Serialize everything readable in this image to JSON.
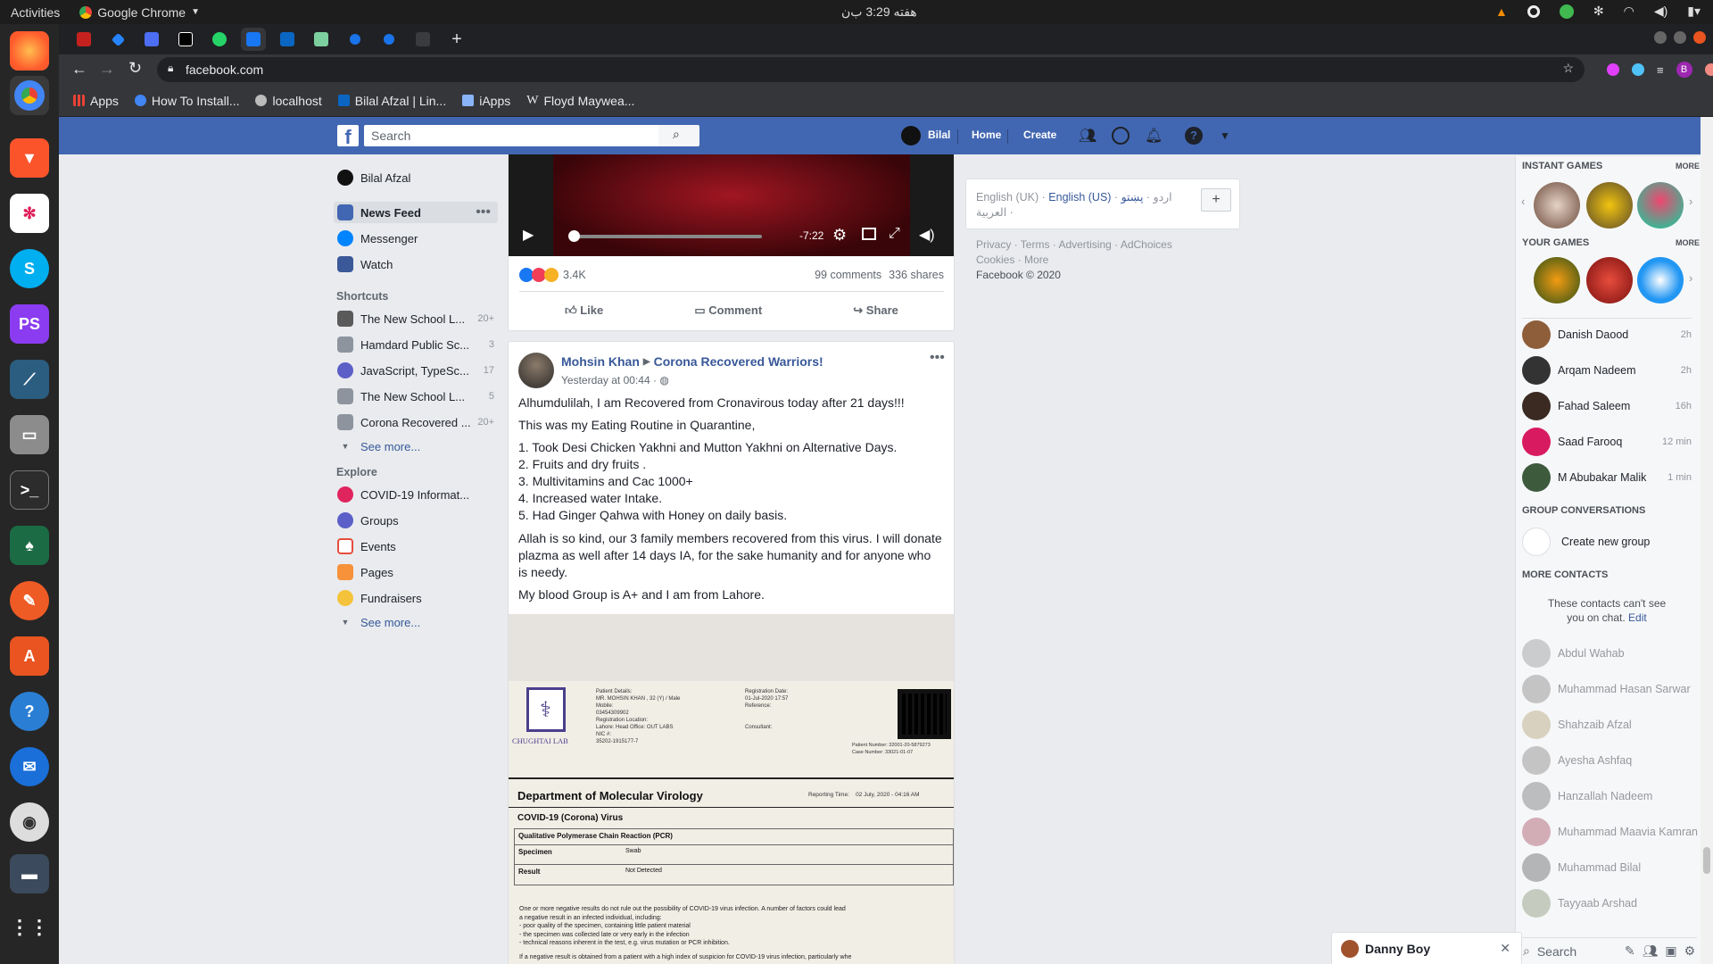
{
  "system": {
    "activities": "Activities",
    "app_name": "Google Chrome",
    "clock": "هفته 3:29 ب‌ن"
  },
  "browser": {
    "url": "facebook.com",
    "bookmarks": [
      "Apps",
      "How To Install...",
      "localhost",
      "Bilal Afzal | Lin...",
      "iApps",
      "Floyd Maywea..."
    ]
  },
  "fb": {
    "search_placeholder": "Search",
    "user_name": "Bilal",
    "nav_home": "Home",
    "nav_create": "Create",
    "sidebar": {
      "profile": "Bilal Afzal",
      "news_feed": "News Feed",
      "messenger": "Messenger",
      "watch": "Watch",
      "shortcuts_title": "Shortcuts",
      "shortcuts": [
        {
          "label": "The New School L...",
          "count": "20+"
        },
        {
          "label": "Hamdard Public Sc...",
          "count": "3"
        },
        {
          "label": "JavaScript, TypeSc...",
          "count": "17"
        },
        {
          "label": "The New School L...",
          "count": "5"
        },
        {
          "label": "Corona Recovered ...",
          "count": "20+"
        }
      ],
      "see_more": "See more...",
      "explore_title": "Explore",
      "explore": [
        "COVID-19 Informat...",
        "Groups",
        "Events",
        "Pages",
        "Fundraisers"
      ]
    },
    "video": {
      "time": "-7:22",
      "reactions_count": "3.4K",
      "comments": "99 comments",
      "shares": "336 shares",
      "like": "Like",
      "comment": "Comment",
      "share": "Share"
    },
    "post": {
      "author": "Mohsin Khan",
      "group": "Corona Recovered Warriors!",
      "time": "Yesterday at 00:44 ·",
      "p1": "Alhumdulilah, I am Recovered from Cronavirous today after 21 days!!!",
      "p2": "This was my Eating Routine in Quarantine,",
      "list": [
        "1. Took Desi Chicken Yakhni and Mutton Yakhni on Alternative Days.",
        "2. Fruits and dry fruits .",
        "3. Multivitamins and Cac 1000+",
        "4. Increased water Intake.",
        "5. Had Ginger Qahwa with Honey on daily basis."
      ],
      "p3a": "Allah is so kind, our 3 family members recovered from this virus. I will donate",
      "p3b": "plazma as well after 14 days IA, for the sake humanity and for anyone who",
      "p3c": "is needy.",
      "p4": "My blood Group is A+ and I am from Lahore."
    },
    "report": {
      "lab": "CHUGHTAI LAB",
      "patient_label": "Patient Details:",
      "patient": "MR. MOHSIN KHAN , 32 (Y) / Male",
      "mobile_label": "Mobile:",
      "mobile": "03454309902",
      "reg_loc_label": "Registration Location:",
      "reg_loc": "Lahore: Head Office: OUT LABS",
      "nic_label": "NIC #:",
      "nic": "35202-1915177-7",
      "reg_date_label": "Registration Date:",
      "reg_date": "01-Jul-2020 17:57",
      "reference_label": "Reference:",
      "consultant_label": "Consultant:",
      "patient_no_label": "Patient Number:",
      "patient_no": "32001-20-5879273",
      "case_no_label": "Case Number:",
      "case_no": "33021-01-07",
      "dept": "Department of Molecular Virology",
      "reporting": "Reporting Time:",
      "reporting_time": "02 July, 2020 - 04:16 AM",
      "test": "COVID-19 (Corona) Virus",
      "method": "Qualitative Polymerase Chain Reaction (PCR)",
      "specimen_label": "Specimen",
      "specimen": "Swab",
      "result_label": "Result",
      "result": "Not Detected",
      "note1": "One or more negative results do not rule out the possibility of COVID-19 virus infection. A number of factors could lead",
      "note2": "a negative result in an infected individual, including:",
      "note3": "- poor quality of the specimen, containing little patient material",
      "note4": "- the specimen was collected late or very early in the infection",
      "note5": "- technical reasons inherent in the test, e.g. virus mutation or PCR inhibition.",
      "note6": "If a negative result is obtained from a patient with a high index of suspicion for COVID-19 virus infection, particularly whe"
    },
    "right": {
      "lang1": "English (UK)",
      "lang2": "English (US)",
      "lang3": "اردو",
      "lang4": "پښتو",
      "lang5": "العربية",
      "footer1": "Privacy · Terms · Advertising · AdChoices",
      "footer2": "Cookies · More",
      "copyright": "Facebook © 2020"
    },
    "chat": {
      "instant_games": "INSTANT GAMES",
      "more": "MORE",
      "your_games": "YOUR GAMES",
      "contacts": [
        {
          "name": "Danish Daood",
          "time": "2h"
        },
        {
          "name": "Arqam Nadeem",
          "time": "2h"
        },
        {
          "name": "Fahad Saleem",
          "time": "16h"
        },
        {
          "name": "Saad Farooq",
          "time": "12 min"
        },
        {
          "name": "M Abubakar Malik",
          "time": "1 min"
        }
      ],
      "group_conv": "GROUP CONVERSATIONS",
      "create_group": "Create new group",
      "more_contacts": "MORE CONTACTS",
      "cant_see1": "These contacts can't see",
      "cant_see2": "you on chat.",
      "edit": "Edit",
      "offline": [
        "Abdul Wahab",
        "Muhammad Hasan Sarwar",
        "Shahzaib Afzal",
        "Ayesha Ashfaq",
        "Hanzallah Nadeem",
        "Muhammad Maavia Kamran",
        "Muhammad Bilal",
        "Tayyaab Arshad"
      ],
      "search": "Search",
      "open_chat": "Danny Boy"
    }
  },
  "colors": {
    "fb_blue": "#4267b2",
    "link": "#385898",
    "dock": "#262626"
  }
}
